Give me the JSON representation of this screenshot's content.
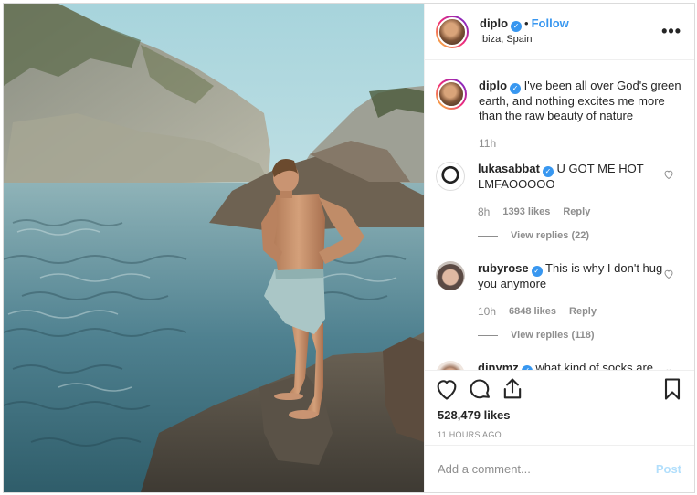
{
  "post": {
    "author": {
      "username": "diplo",
      "verified": true,
      "follow_label": "Follow",
      "location": "Ibiza, Spain",
      "separator": "•"
    },
    "more_icon": "ellipsis-icon",
    "caption": {
      "username": "diplo",
      "text": "I've been all over God's green earth, and nothing excites me more than the raw beauty of nature",
      "time": "11h"
    },
    "comments": [
      {
        "username": "lukasabbat",
        "verified": true,
        "text": "U GOT ME HOT LMFAOOOOO",
        "time": "8h",
        "likes": "1393 likes",
        "reply_label": "Reply",
        "view_replies": "View replies (22)"
      },
      {
        "username": "rubyrose",
        "verified": true,
        "text": "This is why I don't hug you anymore",
        "time": "10h",
        "likes": "6848 likes",
        "reply_label": "Reply",
        "view_replies": "View replies (118)"
      },
      {
        "username": "djnymz",
        "verified": true,
        "text": "what kind of socks are those?"
      }
    ],
    "actions": {
      "like_icon": "heart-icon",
      "comment_icon": "comment-icon",
      "share_icon": "share-icon",
      "save_icon": "bookmark-icon"
    },
    "likes_count": "528,479 likes",
    "posted_ago": "11 HOURS AGO",
    "comment_input": {
      "placeholder": "Add a comment...",
      "value": ""
    },
    "post_button": "Post"
  },
  "colors": {
    "link_blue": "#3897f0",
    "post_disabled": "#b2dffc",
    "muted": "#8e8e8e",
    "text": "#262626",
    "border": "#dbdbdb"
  }
}
